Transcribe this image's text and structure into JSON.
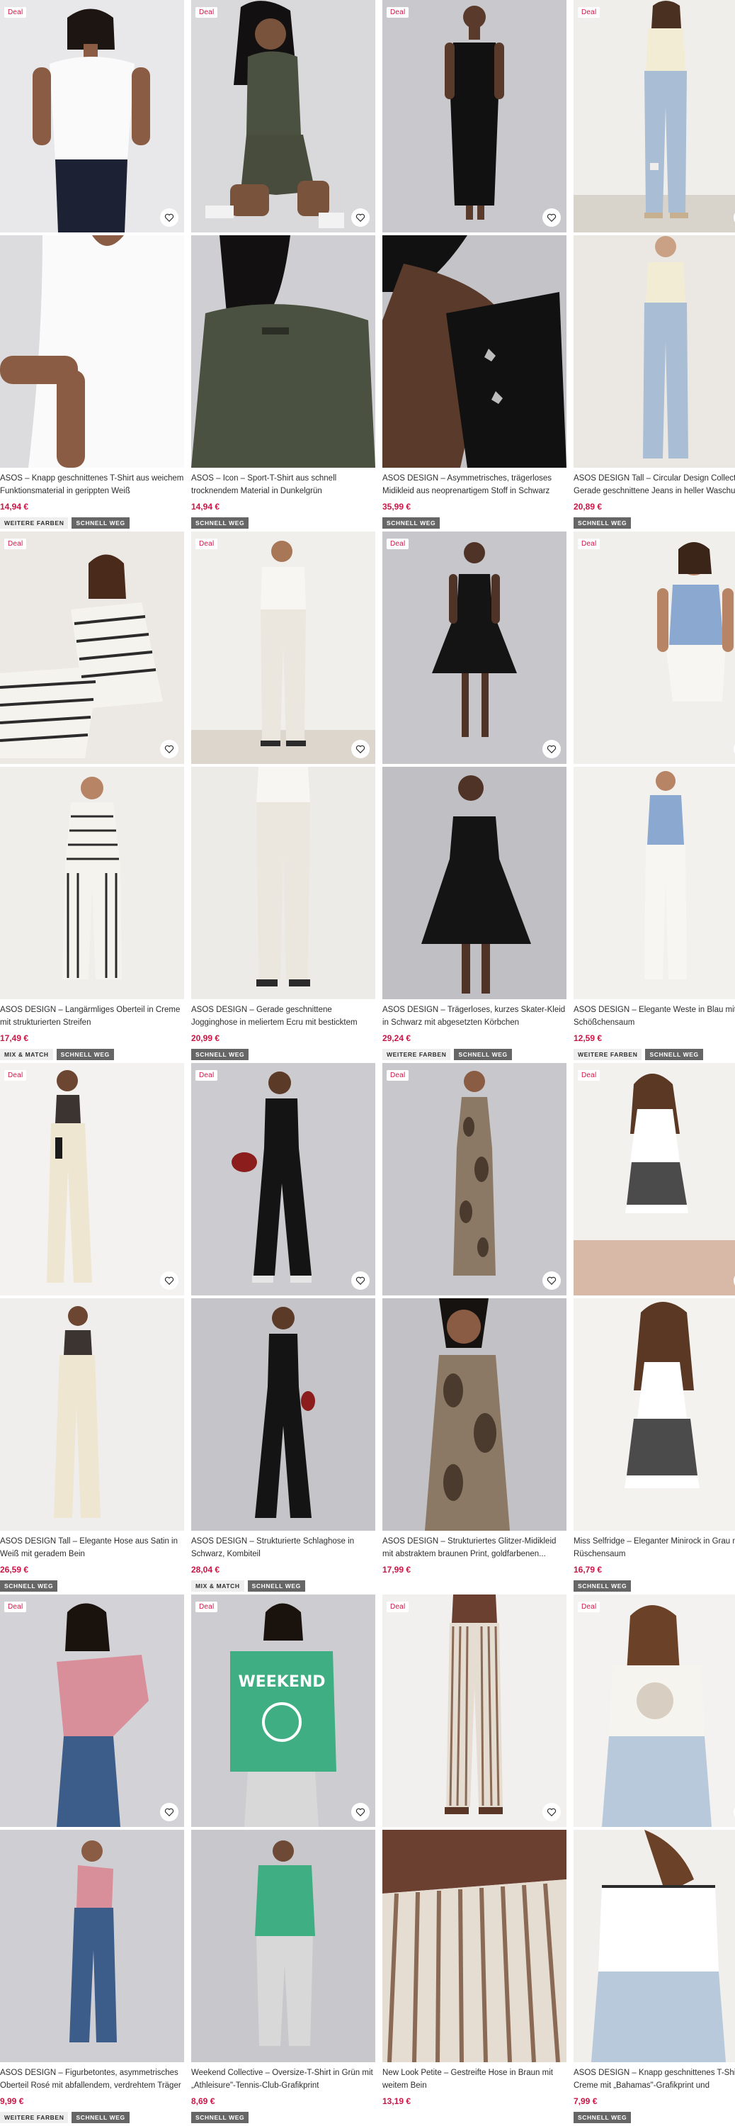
{
  "colors": {
    "accent": "#d01345",
    "deal_bg": "#ffffff",
    "badge_dark": "#666666",
    "badge_light": "#eeeeee"
  },
  "icons": {
    "wishlist": "heart-icon"
  },
  "products": [
    {
      "deal": "Deal",
      "title": "ASOS – Knapp geschnittenes T-Shirt aus weichem Funktionsmaterial in gerippten Weiß",
      "price": "14,94 €",
      "badges": [
        "WEITERE FARBEN",
        "SCHNELL WEG"
      ]
    },
    {
      "deal": "Deal",
      "title": "ASOS – Icon – Sport-T-Shirt aus schnell trocknendem Material in Dunkelgrün",
      "price": "14,94 €",
      "badges": [
        "SCHNELL WEG"
      ]
    },
    {
      "deal": "Deal",
      "title": "ASOS DESIGN – Asymmetrisches, trägerloses Midikleid aus neoprenartigem Stoff in Schwarz mit...",
      "price": "35,99 €",
      "badges": [
        "SCHNELL WEG"
      ]
    },
    {
      "deal": "Deal",
      "title": "ASOS DESIGN Tall – Circular Design Collection – Gerade geschnittene Jeans in heller Waschung",
      "price": "20,89 €",
      "badges": [
        "SCHNELL WEG"
      ]
    },
    {
      "deal": "Deal",
      "title": "ASOS DESIGN – Langärmliges Oberteil in Creme mit strukturierten Streifen",
      "price": "17,49 €",
      "badges": [
        "MIX & MATCH",
        "SCHNELL WEG"
      ]
    },
    {
      "deal": "Deal",
      "title": "ASOS DESIGN – Gerade geschnittene Jogginghose in meliertem Ecru mit besticktem „Marseille\"-Print",
      "price": "20,99 €",
      "badges": [
        "SCHNELL WEG"
      ]
    },
    {
      "deal": "Deal",
      "title": "ASOS DESIGN – Trägerloses, kurzes Skater-Kleid in Schwarz mit abgesetzten Körbchen",
      "price": "29,24 €",
      "badges": [
        "WEITERE FARBEN",
        "SCHNELL WEG"
      ]
    },
    {
      "deal": "Deal",
      "title": "ASOS DESIGN – Elegante Weste in Blau mit Schößchensaum",
      "price": "12,59 €",
      "badges": [
        "WEITERE FARBEN",
        "SCHNELL WEG"
      ]
    },
    {
      "deal": "Deal",
      "title": "ASOS DESIGN Tall – Elegante Hose aus Satin in Weiß mit geradem Bein",
      "price": "26,59 €",
      "badges": [
        "SCHNELL WEG"
      ]
    },
    {
      "deal": "Deal",
      "title": "ASOS DESIGN – Strukturierte Schlaghose in Schwarz, Kombiteil",
      "price": "28,04 €",
      "badges": [
        "MIX & MATCH",
        "SCHNELL WEG"
      ]
    },
    {
      "deal": "Deal",
      "title": "ASOS DESIGN – Strukturiertes Glitzer-Midikleid mit abstraktem braunen Print, goldfarbenen...",
      "price": "17,99 €",
      "badges": []
    },
    {
      "deal": "Deal",
      "title": "Miss Selfridge – Eleganter Minirock in Grau mit Rüschensaum",
      "price": "16,79 €",
      "badges": [
        "SCHNELL WEG"
      ]
    },
    {
      "deal": "Deal",
      "title": "ASOS DESIGN – Figurbetontes, asymmetrisches Oberteil Rosé mit abfallendem, verdrehtem Träger",
      "price": "9,99 €",
      "badges": [
        "WEITERE FARBEN",
        "SCHNELL WEG"
      ]
    },
    {
      "deal": "Deal",
      "title": "Weekend Collective – Oversize-T-Shirt in Grün mit „Athleisure\"-Tennis-Club-Grafikprint",
      "price": "8,69 €",
      "badges": [
        "SCHNELL WEG"
      ]
    },
    {
      "deal": "Deal",
      "title": "New Look Petite – Gestreifte Hose in Braun mit weitem Bein",
      "price": "13,19 €",
      "badges": []
    },
    {
      "deal": "Deal",
      "title": "ASOS DESIGN – Knapp geschnittenes T-Shirt in Creme mit „Bahamas\"-Grafikprint und Kontrastsaum",
      "price": "7,99 €",
      "badges": [
        "SCHNELL WEG"
      ]
    }
  ]
}
